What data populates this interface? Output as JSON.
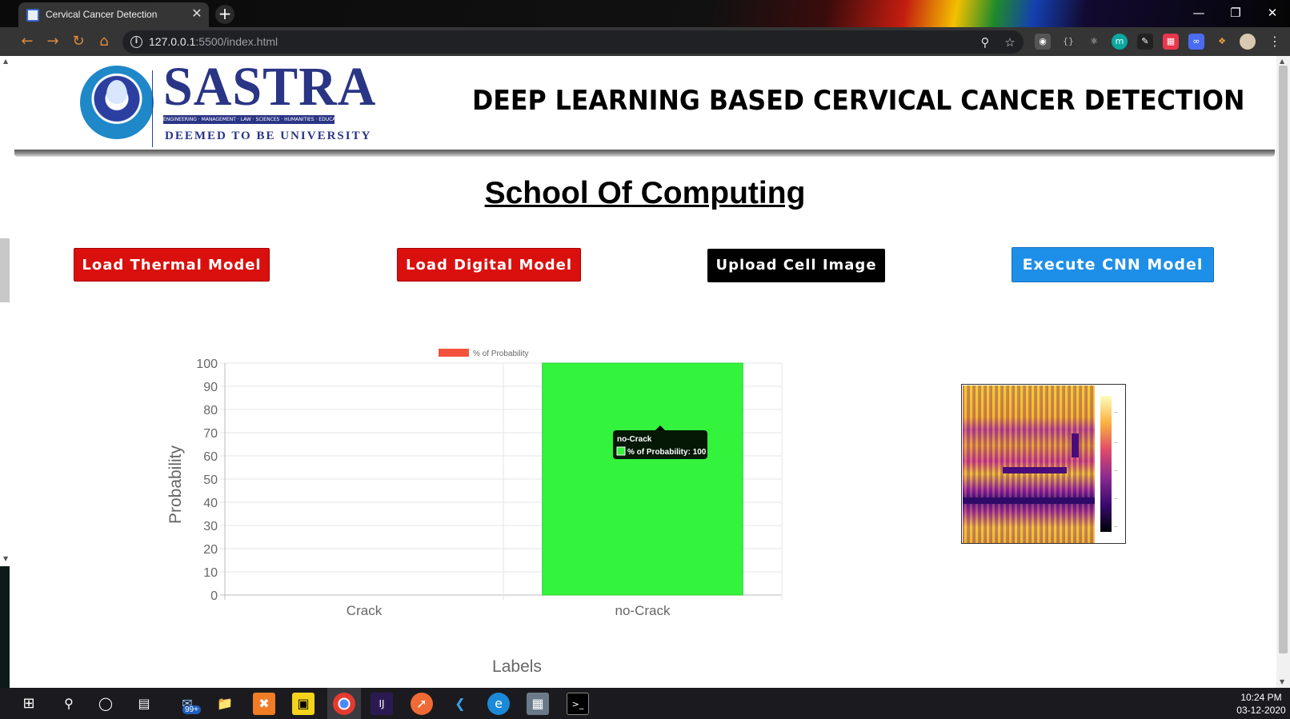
{
  "browser": {
    "tab_title": "Cervical Cancer Detection",
    "url_host": "127.0.0.1",
    "url_rest": ":5500/index.html",
    "close_glyph": "✕",
    "new_tab_glyph": "+"
  },
  "header": {
    "logo_word": "SASTRA",
    "logo_strip": "ENGINEERING · MANAGEMENT · LAW · SCIENCES · HUMANITIES · EDUCATION",
    "logo_deemed": "DEEMED TO BE UNIVERSITY",
    "title": "DEEP LEARNING BASED CERVICAL CANCER DETECTION"
  },
  "page": {
    "school": "School Of Computing"
  },
  "buttons": {
    "load_thermal": "Load Thermal Model",
    "load_digital": "Load Digital Model",
    "upload_image": "Upload Cell Image",
    "execute_cnn": "Execute CNN Model"
  },
  "colors": {
    "button_red": "#d9100d",
    "button_blue": "#1e8fe8",
    "bar_green": "#33f33d",
    "legend_red": "#f4533b"
  },
  "chart_data": {
    "type": "bar",
    "categories": [
      "Crack",
      "no-Crack"
    ],
    "series": [
      {
        "name": "% of Probability",
        "values": [
          0,
          100
        ]
      }
    ],
    "xlabel": "Labels",
    "ylabel": "Probability",
    "ylim": [
      0,
      100
    ],
    "yticks": [
      0,
      10,
      20,
      30,
      40,
      50,
      60,
      70,
      80,
      90,
      100
    ],
    "grid": true,
    "legend": "top",
    "tooltip": {
      "title": "no-Crack",
      "body": "% of Probability: 100"
    }
  },
  "taskbar": {
    "time": "10:24 PM",
    "date": "03-12-2020",
    "mail_badge": "99+"
  }
}
